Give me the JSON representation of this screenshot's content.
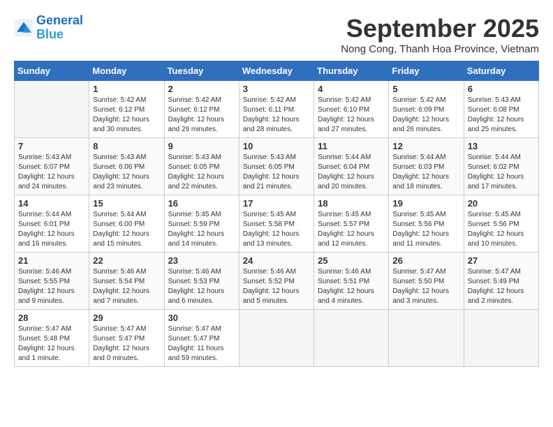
{
  "header": {
    "logo_line1": "General",
    "logo_line2": "Blue",
    "month": "September 2025",
    "location": "Nong Cong, Thanh Hoa Province, Vietnam"
  },
  "weekdays": [
    "Sunday",
    "Monday",
    "Tuesday",
    "Wednesday",
    "Thursday",
    "Friday",
    "Saturday"
  ],
  "weeks": [
    [
      {
        "day": "",
        "info": ""
      },
      {
        "day": "1",
        "info": "Sunrise: 5:42 AM\nSunset: 6:12 PM\nDaylight: 12 hours\nand 30 minutes."
      },
      {
        "day": "2",
        "info": "Sunrise: 5:42 AM\nSunset: 6:12 PM\nDaylight: 12 hours\nand 29 minutes."
      },
      {
        "day": "3",
        "info": "Sunrise: 5:42 AM\nSunset: 6:11 PM\nDaylight: 12 hours\nand 28 minutes."
      },
      {
        "day": "4",
        "info": "Sunrise: 5:42 AM\nSunset: 6:10 PM\nDaylight: 12 hours\nand 27 minutes."
      },
      {
        "day": "5",
        "info": "Sunrise: 5:42 AM\nSunset: 6:09 PM\nDaylight: 12 hours\nand 26 minutes."
      },
      {
        "day": "6",
        "info": "Sunrise: 5:43 AM\nSunset: 6:08 PM\nDaylight: 12 hours\nand 25 minutes."
      }
    ],
    [
      {
        "day": "7",
        "info": "Sunrise: 5:43 AM\nSunset: 6:07 PM\nDaylight: 12 hours\nand 24 minutes."
      },
      {
        "day": "8",
        "info": "Sunrise: 5:43 AM\nSunset: 6:06 PM\nDaylight: 12 hours\nand 23 minutes."
      },
      {
        "day": "9",
        "info": "Sunrise: 5:43 AM\nSunset: 6:05 PM\nDaylight: 12 hours\nand 22 minutes."
      },
      {
        "day": "10",
        "info": "Sunrise: 5:43 AM\nSunset: 6:05 PM\nDaylight: 12 hours\nand 21 minutes."
      },
      {
        "day": "11",
        "info": "Sunrise: 5:44 AM\nSunset: 6:04 PM\nDaylight: 12 hours\nand 20 minutes."
      },
      {
        "day": "12",
        "info": "Sunrise: 5:44 AM\nSunset: 6:03 PM\nDaylight: 12 hours\nand 18 minutes."
      },
      {
        "day": "13",
        "info": "Sunrise: 5:44 AM\nSunset: 6:02 PM\nDaylight: 12 hours\nand 17 minutes."
      }
    ],
    [
      {
        "day": "14",
        "info": "Sunrise: 5:44 AM\nSunset: 6:01 PM\nDaylight: 12 hours\nand 16 minutes."
      },
      {
        "day": "15",
        "info": "Sunrise: 5:44 AM\nSunset: 6:00 PM\nDaylight: 12 hours\nand 15 minutes."
      },
      {
        "day": "16",
        "info": "Sunrise: 5:45 AM\nSunset: 5:59 PM\nDaylight: 12 hours\nand 14 minutes."
      },
      {
        "day": "17",
        "info": "Sunrise: 5:45 AM\nSunset: 5:58 PM\nDaylight: 12 hours\nand 13 minutes."
      },
      {
        "day": "18",
        "info": "Sunrise: 5:45 AM\nSunset: 5:57 PM\nDaylight: 12 hours\nand 12 minutes."
      },
      {
        "day": "19",
        "info": "Sunrise: 5:45 AM\nSunset: 5:56 PM\nDaylight: 12 hours\nand 11 minutes."
      },
      {
        "day": "20",
        "info": "Sunrise: 5:45 AM\nSunset: 5:56 PM\nDaylight: 12 hours\nand 10 minutes."
      }
    ],
    [
      {
        "day": "21",
        "info": "Sunrise: 5:46 AM\nSunset: 5:55 PM\nDaylight: 12 hours\nand 9 minutes."
      },
      {
        "day": "22",
        "info": "Sunrise: 5:46 AM\nSunset: 5:54 PM\nDaylight: 12 hours\nand 7 minutes."
      },
      {
        "day": "23",
        "info": "Sunrise: 5:46 AM\nSunset: 5:53 PM\nDaylight: 12 hours\nand 6 minutes."
      },
      {
        "day": "24",
        "info": "Sunrise: 5:46 AM\nSunset: 5:52 PM\nDaylight: 12 hours\nand 5 minutes."
      },
      {
        "day": "25",
        "info": "Sunrise: 5:46 AM\nSunset: 5:51 PM\nDaylight: 12 hours\nand 4 minutes."
      },
      {
        "day": "26",
        "info": "Sunrise: 5:47 AM\nSunset: 5:50 PM\nDaylight: 12 hours\nand 3 minutes."
      },
      {
        "day": "27",
        "info": "Sunrise: 5:47 AM\nSunset: 5:49 PM\nDaylight: 12 hours\nand 2 minutes."
      }
    ],
    [
      {
        "day": "28",
        "info": "Sunrise: 5:47 AM\nSunset: 5:48 PM\nDaylight: 12 hours\nand 1 minute."
      },
      {
        "day": "29",
        "info": "Sunrise: 5:47 AM\nSunset: 5:47 PM\nDaylight: 12 hours\nand 0 minutes."
      },
      {
        "day": "30",
        "info": "Sunrise: 5:47 AM\nSunset: 5:47 PM\nDaylight: 11 hours\nand 59 minutes."
      },
      {
        "day": "",
        "info": ""
      },
      {
        "day": "",
        "info": ""
      },
      {
        "day": "",
        "info": ""
      },
      {
        "day": "",
        "info": ""
      }
    ]
  ]
}
